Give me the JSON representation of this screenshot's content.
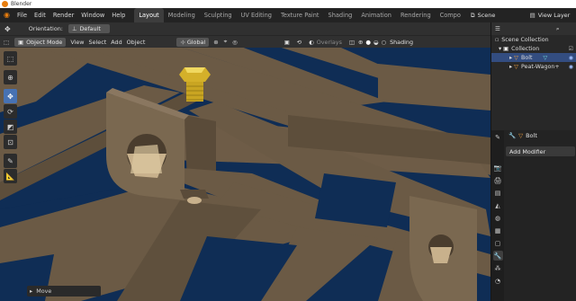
{
  "title_bar": {
    "app_name": "Blender"
  },
  "menu": [
    "File",
    "Edit",
    "Render",
    "Window",
    "Help"
  ],
  "workspaces": [
    "Layout",
    "Modeling",
    "Sculpting",
    "UV Editing",
    "Texture Paint",
    "Shading",
    "Animation",
    "Rendering",
    "Compo"
  ],
  "active_workspace": "Layout",
  "scene": {
    "label": "Scene",
    "view_layer": "View Layer"
  },
  "tool_header": {
    "orientation_label": "Orientation:",
    "orientation_value": "Default"
  },
  "viewport_header": {
    "mode": "Object Mode",
    "menus": [
      "View",
      "Select",
      "Add",
      "Object"
    ],
    "transform_orientation": "Global",
    "overlays": "Overlays",
    "shading": "Shading"
  },
  "toolbar_tools": [
    "select-box",
    "cursor",
    "move",
    "rotate",
    "scale",
    "transform",
    "annotate",
    "measure"
  ],
  "active_tool": "move",
  "operator_panel": {
    "label": "Move"
  },
  "outliner": {
    "root": "Scene Collection",
    "collection": "Collection",
    "items": [
      {
        "name": "Bolt",
        "selected": true
      },
      {
        "name": "Peat-Wagon+",
        "selected": false
      }
    ]
  },
  "properties": {
    "object_name": "Bolt",
    "add_modifier": "Add Modifier"
  },
  "colors": {
    "accent": "#4772b3",
    "selection": "#334d80",
    "ground": "#0f2d55",
    "wood": "#6b5a45",
    "bolt": "#d4b02a"
  }
}
